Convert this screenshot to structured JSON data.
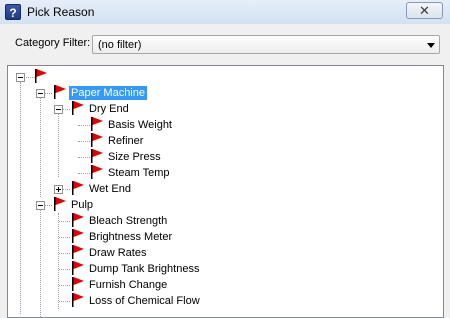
{
  "window": {
    "title": "Pick Reason",
    "title_icon": "?",
    "close_symbol": "✕"
  },
  "filter": {
    "label": "Category Filter:",
    "value": "(no filter)"
  },
  "tree": {
    "selected_color": "#3399ff",
    "flag_color": "#e00000",
    "nodes": {
      "root": {
        "label": "",
        "expanded": true
      },
      "paper_machine": {
        "label": "Paper Machine",
        "expanded": true,
        "selected": true
      },
      "dry_end": {
        "label": "Dry End",
        "expanded": true
      },
      "basis_weight": {
        "label": "Basis Weight"
      },
      "refiner": {
        "label": "Refiner"
      },
      "size_press": {
        "label": "Size Press"
      },
      "steam_temp": {
        "label": "Steam Temp"
      },
      "wet_end": {
        "label": "Wet End",
        "expanded": false
      },
      "pulp": {
        "label": "Pulp",
        "expanded": true
      },
      "bleach_strength": {
        "label": "Bleach Strength"
      },
      "brightness_meter": {
        "label": "Brightness Meter"
      },
      "draw_rates": {
        "label": "Draw Rates"
      },
      "dump_tank_brightness": {
        "label": "Dump Tank Brightness"
      },
      "furnish_change": {
        "label": "Furnish Change"
      },
      "loss_of_chemical_flow": {
        "label": "Loss of Chemical Flow"
      }
    }
  }
}
